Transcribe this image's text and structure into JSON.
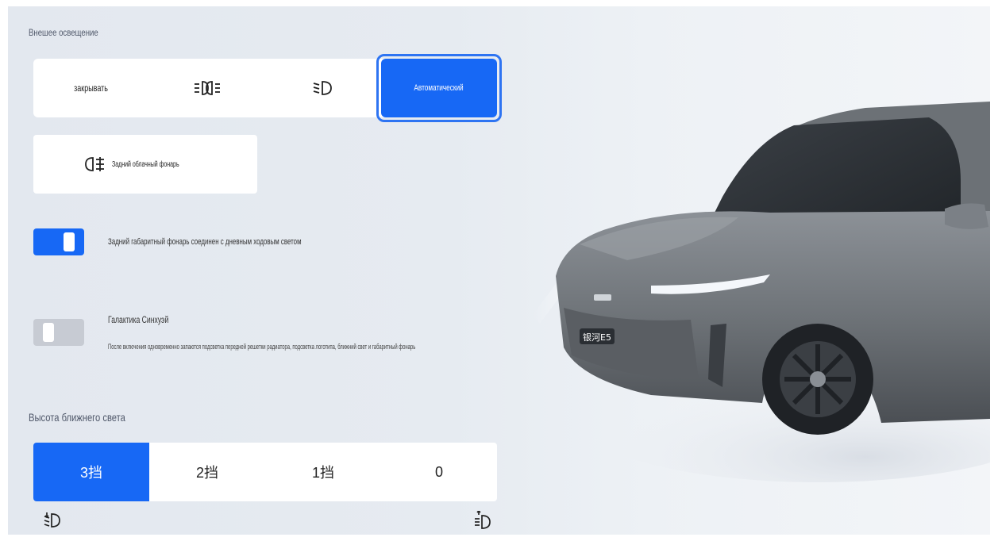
{
  "exterior_lighting": {
    "title": "Внешее освещение",
    "modes": [
      {
        "label": "закрывать",
        "icon": "text"
      },
      {
        "label": "",
        "icon": "parking-lights-icon"
      },
      {
        "label": "",
        "icon": "low-beam-icon"
      },
      {
        "label": "Автоматический",
        "icon": "text"
      }
    ],
    "active_mode": 3,
    "rear_fog": {
      "label": "Задний облачный фонарь",
      "icon": "rear-fog-light-icon"
    }
  },
  "toggles": {
    "rear_position_drl": {
      "label": "Задний габаритный фонарь соединен с дневным ходовым светом",
      "state": true
    },
    "galaxy": {
      "label": "Галактика Синхуэй",
      "description": "После включения одновременно запаются подсветка передней решетки радиатора, подсветка логотипа, ближний свет и габаритный фонарь",
      "state": false
    }
  },
  "beam_height": {
    "title": "Высота ближнего света",
    "levels": [
      "3挡",
      "2挡",
      "1挡",
      "0"
    ],
    "active_level": 0,
    "icons": {
      "left": "beam-down-icon",
      "right": "beam-up-icon"
    }
  },
  "car": {
    "badge": "银河E5"
  },
  "colors": {
    "accent": "#1768f5",
    "panel": "#ffffff",
    "toggle_off": "#c7cbd3"
  }
}
